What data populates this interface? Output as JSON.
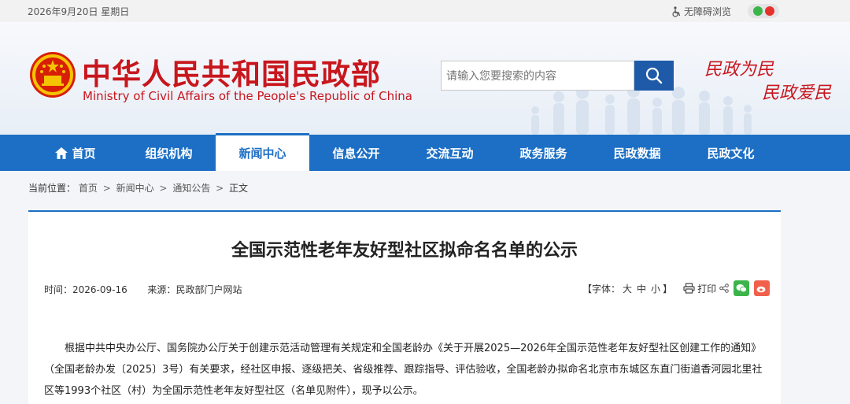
{
  "topbar": {
    "date": "2026年9月20日 星期日",
    "accessibility": "无障碍浏览"
  },
  "header": {
    "title_cn": "中华人民共和国民政部",
    "title_en": "Ministry of Civil Affairs of the People's Republic of China",
    "search_placeholder": "请输入您要搜索的内容",
    "slogan_1": "民政为民",
    "slogan_2": "民政爱民"
  },
  "nav": {
    "items": [
      {
        "label": "首页"
      },
      {
        "label": "组织机构"
      },
      {
        "label": "新闻中心"
      },
      {
        "label": "信息公开"
      },
      {
        "label": "交流互动"
      },
      {
        "label": "政务服务"
      },
      {
        "label": "民政数据"
      },
      {
        "label": "民政文化"
      }
    ],
    "active_index": 2
  },
  "breadcrumb": {
    "prefix": "当前位置：",
    "items": [
      "首页",
      "新闻中心",
      "通知公告",
      "正文"
    ]
  },
  "article": {
    "title": "全国示范性老年友好型社区拟命名名单的公示",
    "time_label": "时间：",
    "time_value": "2026-09-16",
    "source_label": "来源：",
    "source_value": "民政部门户网站",
    "font_label": "【字体：",
    "font_large": "大",
    "font_medium": "中",
    "font_small": "小",
    "font_close": "】",
    "print_label": "打印",
    "body": "根据中共中央办公厅、国务院办公厅关于创建示范活动管理有关规定和全国老龄办《关于开展2025—2026年全国示范性老年友好型社区创建工作的通知》（全国老龄办发〔2025〕3号）有关要求，经社区申报、逐级把关、省级推荐、跟踪指导、评估验收，全国老龄办拟命名北京市东城区东直门街道香河园北里社区等1993个社区（村）为全国示范性老年友好型社区（名单见附件），现予以公示。"
  },
  "colors": {
    "brand_red": "#c8161d",
    "nav_blue": "#1c6fc4",
    "search_blue": "#1e5aa8",
    "wechat_green": "#3bb54a",
    "weibo_orange": "#f0604b"
  }
}
